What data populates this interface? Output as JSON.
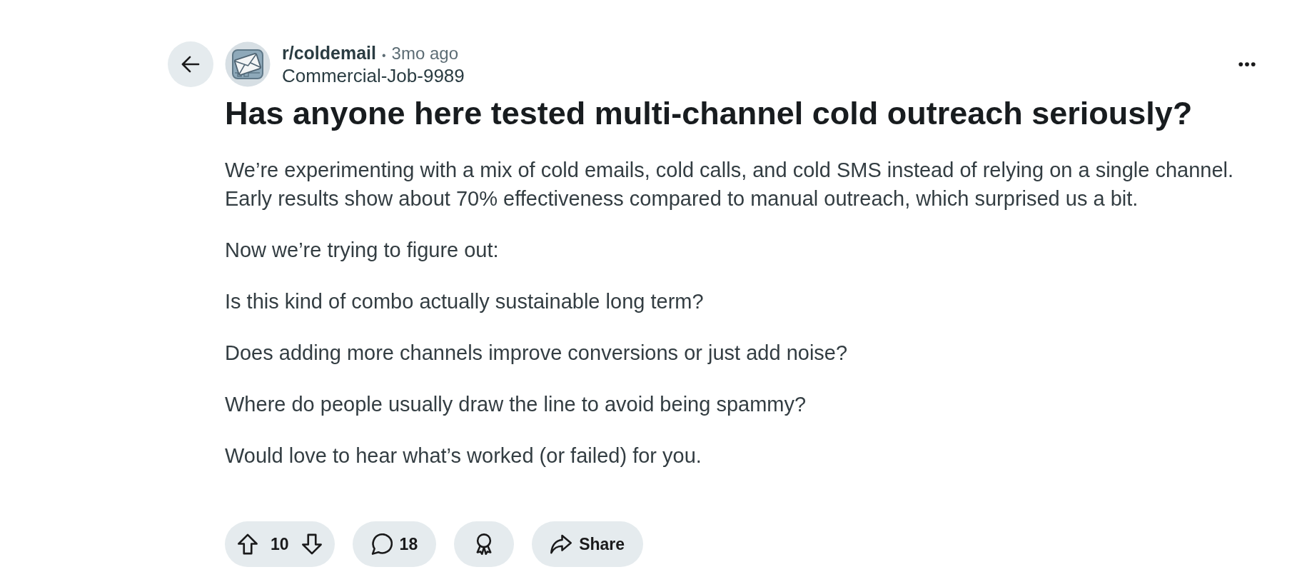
{
  "post": {
    "subreddit": "r/coldemail",
    "separator": "•",
    "time": "3mo ago",
    "author": "Commercial-Job-9989",
    "title": "Has anyone here tested multi-channel cold outreach seriously?",
    "body": [
      "We’re experimenting with a mix of cold emails, cold calls, and cold SMS instead of relying on a single channel. Early results show about 70% effectiveness compared to manual outreach, which surprised us a bit.",
      "Now we’re trying to figure out:",
      "Is this kind of combo actually sustainable long term?",
      "Does adding more channels improve conversions or just add noise?",
      "Where do people usually draw the line to avoid being spammy?",
      "Would love to hear what’s worked (or failed) for you."
    ]
  },
  "actions": [
    {
      "kind": "vote",
      "label": "10"
    },
    {
      "kind": "comment",
      "label": "18"
    },
    {
      "kind": "award"
    },
    {
      "kind": "share",
      "label": "Share"
    }
  ]
}
